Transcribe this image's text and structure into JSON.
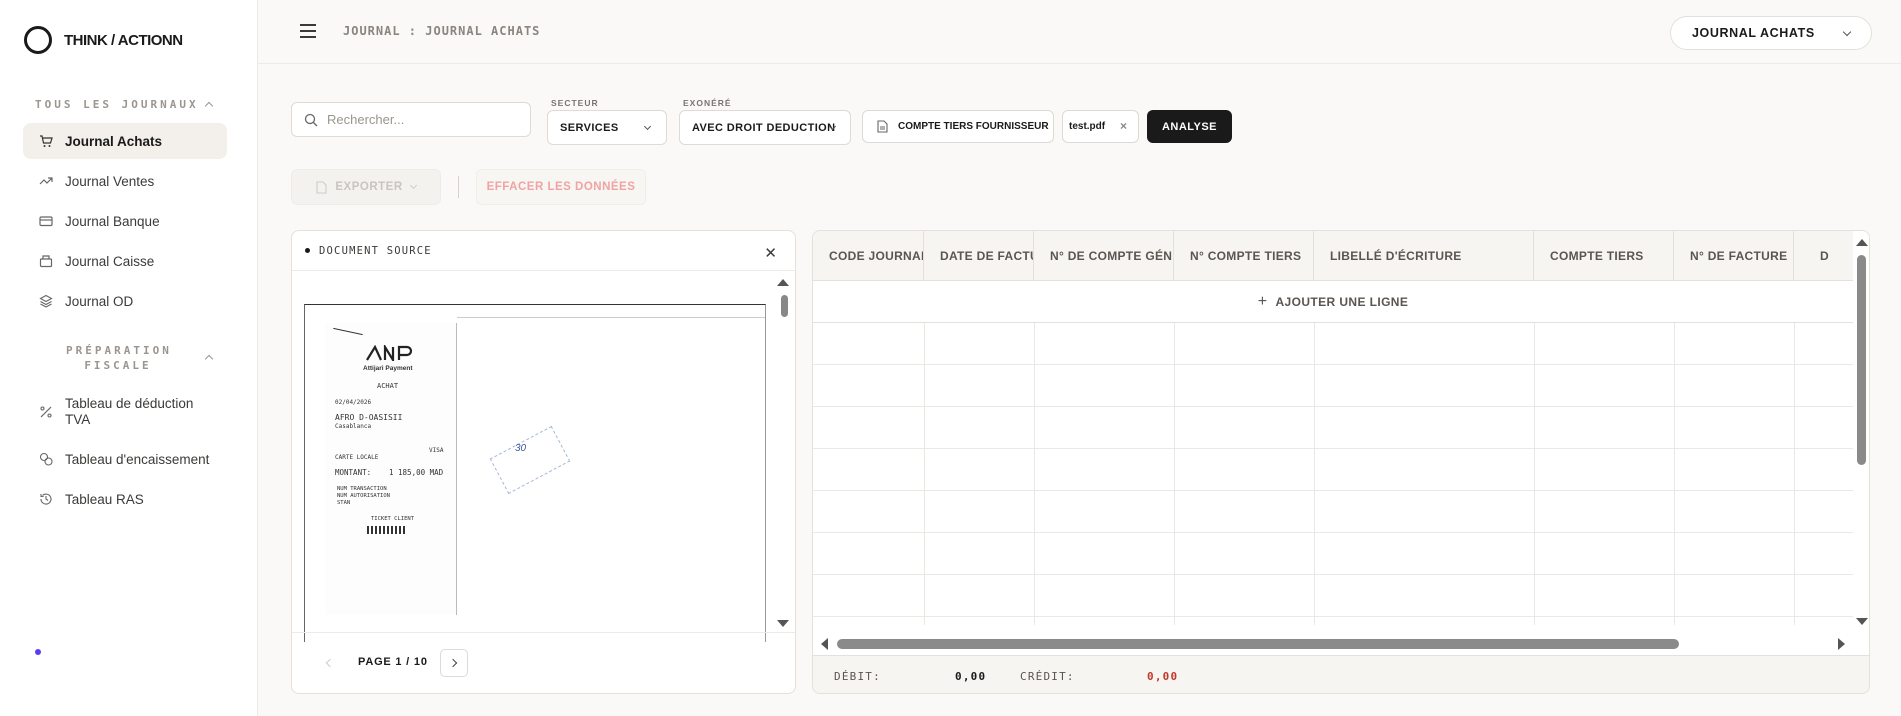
{
  "app": {
    "logo_text": "THINK / ACTIONN"
  },
  "sidebar": {
    "section1_title": "TOUS LES JOURNAUX",
    "items": [
      {
        "label": "Journal Achats",
        "icon": "cart-icon",
        "active": true
      },
      {
        "label": "Journal Ventes",
        "icon": "trending-up-icon"
      },
      {
        "label": "Journal Banque",
        "icon": "credit-card-icon"
      },
      {
        "label": "Journal Caisse",
        "icon": "cash-register-icon"
      },
      {
        "label": "Journal OD",
        "icon": "layers-icon"
      }
    ],
    "section2_title_line1": "PRÉPARATION",
    "section2_title_line2": "FISCALE",
    "fiscal_items": [
      {
        "label": "Tableau de déduction TVA",
        "icon": "percent-icon"
      },
      {
        "label": "Tableau d'encaissement",
        "icon": "coins-icon"
      },
      {
        "label": "Tableau RAS",
        "icon": "history-icon"
      }
    ]
  },
  "header": {
    "breadcrumb": "JOURNAL : JOURNAL ACHATS",
    "journal_select": "JOURNAL ACHATS"
  },
  "toolbar": {
    "search_placeholder": "Rechercher...",
    "secteur_label": "SECTEUR",
    "secteur_value": "SERVICES",
    "exonere_label": "EXONÉRÉ",
    "exonere_value": "AVEC DROIT DEDUCTION",
    "compte_tiers": "COMPTE TIERS FOURNISSEUR",
    "file_name": "test.pdf",
    "analyse": "ANALYSE",
    "export": "EXPORTER",
    "clear": "EFFACER LES DONNÉES"
  },
  "document": {
    "title": "DOCUMENT SOURCE",
    "page_label": "PAGE 1 / 10",
    "receipt": {
      "brand": "Attijari Payment",
      "type": "ACHAT",
      "date": "02/04/2026",
      "merchant": "AFRO D-OASISII",
      "city": "Casablanca",
      "card_type": "VISA",
      "card_label": "CARTE LOCALE",
      "amount_label": "MONTANT:",
      "amount": "1 185,00 MAD",
      "txn_label": "NUM TRANSACTION",
      "auth_label": "NUM AUTORISATION",
      "stan_label": "STAN",
      "footer": "TICKET CLIENT",
      "handwritten": "30"
    }
  },
  "table": {
    "columns": [
      "CODE JOURNAL",
      "DATE DE FACTURE",
      "N° DE COMPTE GÉNÉRAL",
      "N° COMPTE TIERS",
      "LIBELLÉ D'ÉCRITURE",
      "COMPTE TIERS",
      "N° DE FACTURE",
      "D"
    ],
    "add_row": "AJOUTER UNE LIGNE",
    "debit_label": "DÉBIT:",
    "debit_value": "0,00",
    "credit_label": "CRÉDIT:",
    "credit_value": "0,00"
  },
  "colors": {
    "accent_dark": "#1a1a1a",
    "credit_red": "#c0392b",
    "status_dot": "#5a3df0"
  }
}
